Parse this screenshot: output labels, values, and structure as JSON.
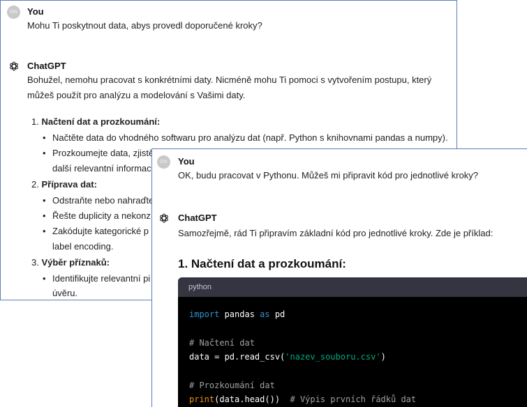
{
  "back": {
    "user_name": "You",
    "user_initials": "ON",
    "user_message": "Mohu Ti poskytnout data, abys provedl doporučené kroky?",
    "assistant_name": "ChatGPT",
    "assistant_line1": "Bohužel, nemohu pracovat s konkrétními daty. Nicméně mohu Ti pomoci s vytvořením postupu, který",
    "assistant_line2": "můžeš použít pro analýzu a modelování s Vašimi daty.",
    "steps": [
      {
        "number": "1.",
        "title": "Načtení dat a prozkoumání:",
        "bullets": [
          "Načtěte data do vhodného softwaru pro analýzu dat (např. Python s knihovnami pandas a numpy).",
          "Prozkoumejte data, zjistěte jejich strukturu, chybějící hodnoty, odlehlé hodnoty a další",
          "další relevantní informace."
        ]
      },
      {
        "number": "2.",
        "title": "Příprava dat:",
        "bullets": [
          "Odstraňte nebo nahraďte",
          "Řešte duplicity a nekonz",
          "Zakódujte kategorické p",
          "label encoding."
        ]
      },
      {
        "number": "3.",
        "title": "Výběr příznaků:",
        "bullets": [
          "Identifikujte relevantní pi",
          "úvěru."
        ]
      }
    ]
  },
  "front": {
    "user_name": "You",
    "user_initials": "ON",
    "user_message": "OK, budu pracovat v Pythonu. Můžeš mi připravit kód pro jednotlivé kroky?",
    "assistant_name": "ChatGPT",
    "assistant_message": "Samozřejmě, rád Ti připravím základní kód pro jednotlivé kroky. Zde je příklad:",
    "heading": "1. Načtení dat a prozkoumání:",
    "code_language": "python",
    "code": {
      "l1_kw1": "import",
      "l1_mod": " pandas ",
      "l1_kw2": "as",
      "l1_alias": " pd",
      "l2": "# Načtení dat",
      "l3_a": "data = pd.read_csv(",
      "l3_str": "'nazev_souboru.csv'",
      "l3_b": ")",
      "l4": "# Prozkoumání dat",
      "l5_fn": "print",
      "l5_a": "(data.head())  ",
      "l5_cm": "# Výpis prvních řádků dat"
    }
  },
  "colors": {
    "panel_border": "#5b7fb5",
    "code_bg": "#000000",
    "code_header_bg": "#343541",
    "keyword": "#2e95d3",
    "string": "#00a67d",
    "comment": "#a0a0a0"
  }
}
